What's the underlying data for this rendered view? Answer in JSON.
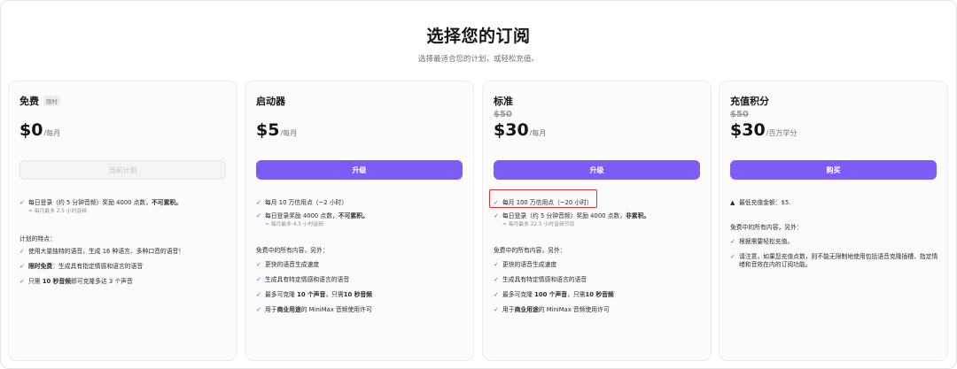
{
  "header": {
    "title": "选择您的订阅",
    "subtitle": "选择最适合您的计划，或轻松充值。"
  },
  "plans": [
    {
      "name": "免费",
      "badge": "限时",
      "price": "$0",
      "per": "/每月",
      "button": "当前计划",
      "features": [
        {
          "a": "每日登录（约 5 分钟音频）奖励 4000 点数，",
          "b": "不可累积。"
        },
        {
          "note": "≈ 每月最多 2.5 小时音频"
        }
      ],
      "section": "计划的特点：",
      "extras": [
        {
          "a": "使用大量独特的语音，生成 16 种语言、多种口音的语音！"
        },
        {
          "b": "限时免费",
          "a": "：生成具有指定情感和语言的语音"
        },
        {
          "a1": "只需 ",
          "b": "10 秒音频",
          "a2": "即可克隆多达 3 个声音"
        }
      ]
    },
    {
      "name": "启动器",
      "price": "$5",
      "per": "/每月",
      "button": "升级",
      "features": [
        {
          "a": "每月 10 万信用点（~2 小时）"
        },
        {
          "a": "每日登录奖励 4000 点数，",
          "b": "不可累积。"
        },
        {
          "note": "≈ 每月最多 4.5 小时音频"
        }
      ],
      "section": "免费中的所有内容，另外：",
      "extras": [
        {
          "a": "更快的语音生成速度"
        },
        {
          "a": "生成具有特定情感和语言的语音"
        },
        {
          "a1": "最多可克隆 ",
          "b1": "10 个声音",
          "a2": "，只需",
          "b2": "10 秒音频"
        },
        {
          "a1": "用于",
          "b": "商业用途",
          "a2": "的 MiniMax 音频使用许可"
        }
      ]
    },
    {
      "name": "标准",
      "old_price": "$50",
      "price": "$30",
      "per": "/每月",
      "button": "升级",
      "features": [
        {
          "a": "每月 100 万信用点（~20 小时）"
        },
        {
          "a": "每日登录（约 5 分钟音频）奖励 4000 点数，",
          "b": "非累积。"
        },
        {
          "note": "≈ 每月最多 22.5 小时音频节目"
        }
      ],
      "section": "免费中的所有内容，另外：",
      "extras": [
        {
          "a": "更快的语音生成速度"
        },
        {
          "a": "生成具有特定情感和语言的语音"
        },
        {
          "a1": "最多可克隆 ",
          "b1": "100 个声音",
          "a2": "，只需",
          "b2": "10 秒音频"
        },
        {
          "a1": "用于",
          "b": "商业用途",
          "a2": "的 MiniMax 音频使用许可"
        }
      ]
    },
    {
      "name": "充值积分",
      "old_price": "$50",
      "price": "$30",
      "per": "/百万学分",
      "button": "购买",
      "features": [
        {
          "a": "最低充值金额：$5."
        }
      ],
      "section": "免费中的所有内容，另外：",
      "extras": [
        {
          "a": "根据需要轻松充值。"
        },
        {
          "a": "请注意，如果您充值点数，则不能无限制地使用包括语音克隆插槽、指定情绪和音效在内的订阅功能。"
        }
      ]
    }
  ],
  "colors": {
    "accent": "#7c5cf6",
    "highlight": "#e03131"
  }
}
